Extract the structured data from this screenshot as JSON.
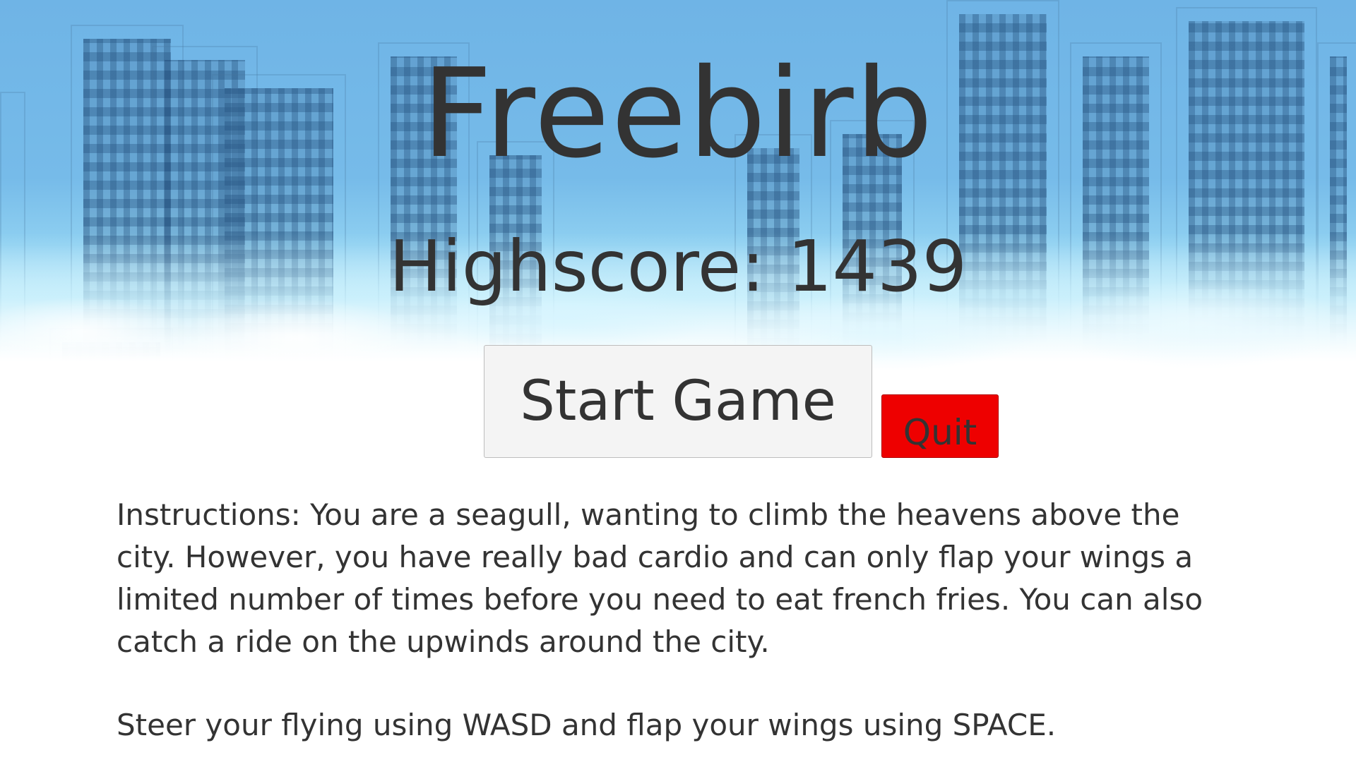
{
  "game": {
    "title": "Freebirb",
    "highscore_text": "Highscore: 1439",
    "start_button_label": "Start Game",
    "quit_button_label": "Quit",
    "instructions": "Instructions: You are a seagull, wanting to climb the heavens above the city. However, you have really bad cardio and can only flap your wings a limited number of times before you need to eat french fries. You can also catch a ride on the upwinds around the city.",
    "controls": "Steer your flying using WASD and flap your wings using SPACE."
  },
  "colors": {
    "sky": "#6fb4e6",
    "text": "#333333",
    "start_button_bg": "#f4f4f4",
    "quit_button_bg": "#ee0000"
  }
}
